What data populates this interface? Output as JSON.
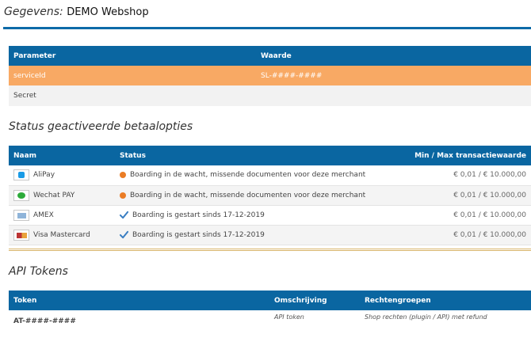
{
  "header": {
    "label": "Gegevens:",
    "shop_name": "DEMO Webshop"
  },
  "params": {
    "columns": [
      "Parameter",
      "Waarde"
    ],
    "rows": [
      {
        "name": "serviceId",
        "value": "SL-####-####"
      },
      {
        "name": "Secret",
        "value": ""
      }
    ]
  },
  "methods": {
    "title": "Status geactiveerde betaalopties",
    "columns": [
      "Naam",
      "Status",
      "Min / Max transactiewaarde"
    ],
    "rows": [
      {
        "name": "AliPay",
        "icon": "alipay-icon",
        "status_icon": "pending-dot-icon",
        "status": "Boarding in de wacht, missende documenten voor deze merchant",
        "amount": "€ 0,01 / € 10.000,00"
      },
      {
        "name": "Wechat PAY",
        "icon": "wechat-icon",
        "status_icon": "pending-dot-icon",
        "status": "Boarding in de wacht, missende documenten voor deze merchant",
        "amount": "€ 0,01 / € 10.000,00"
      },
      {
        "name": "AMEX",
        "icon": "amex-icon",
        "status_icon": "checkmark-icon",
        "status": "Boarding is gestart sinds 17-12-2019",
        "amount": "€ 0,01 / € 10.000,00"
      },
      {
        "name": "Visa Mastercard",
        "icon": "visa-mastercard-icon",
        "status_icon": "checkmark-icon",
        "status": "Boarding is gestart sinds 17-12-2019",
        "amount": "€ 0,01 / € 10.000,00"
      }
    ]
  },
  "tokens": {
    "title": "API Tokens",
    "columns": [
      "Token",
      "Omschrijving",
      "Rechtengroepen"
    ],
    "rows": [
      {
        "token": "AT-####-####",
        "description": "API token",
        "rights": "Shop rechten (plugin / API) met refund"
      }
    ]
  },
  "colors": {
    "header_blue": "#0a66a1",
    "highlight_orange": "#f8a964",
    "pending_orange": "#ea7c25",
    "check_blue": "#3a7ec2"
  }
}
